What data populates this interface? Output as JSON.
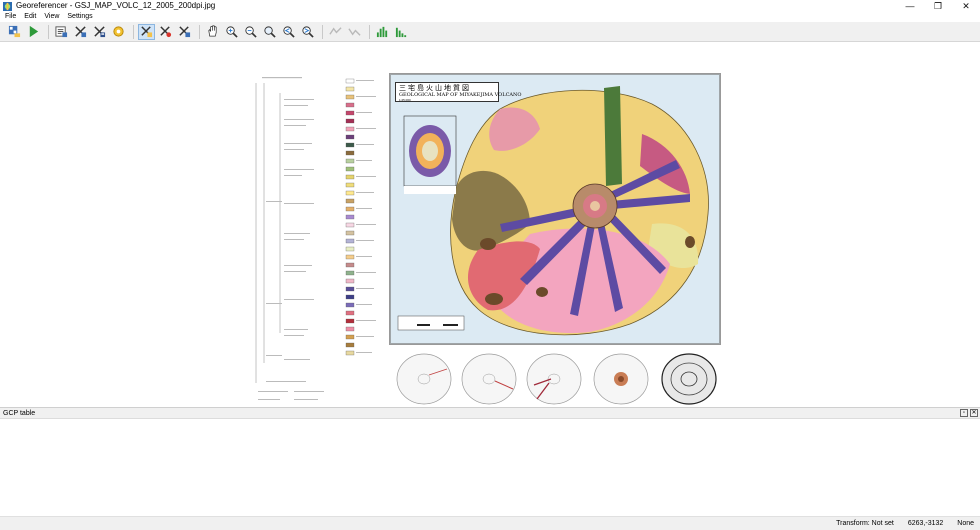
{
  "window": {
    "title": "Georeferencer - GSJ_MAP_VOLC_12_2005_200dpi.jpg",
    "minimize": "—",
    "maximize": "❐",
    "close": "✕"
  },
  "menu": [
    "File",
    "Edit",
    "View",
    "Settings"
  ],
  "toolbar": {
    "buttons": [
      {
        "name": "open-raster",
        "icon": "open-raster-icon"
      },
      {
        "name": "start-georeferencing",
        "icon": "play-icon"
      },
      {
        "name": "generate-gdal-script",
        "icon": "script-icon"
      },
      {
        "name": "load-gcp-points",
        "icon": "load-gcp-icon"
      },
      {
        "name": "save-gcp-points",
        "icon": "save-gcp-icon"
      },
      {
        "name": "transformation-settings",
        "icon": "gear-icon"
      },
      {
        "name": "add-point",
        "icon": "add-point-icon",
        "active": true
      },
      {
        "name": "delete-point",
        "icon": "delete-point-icon"
      },
      {
        "name": "move-gcp-point",
        "icon": "move-point-icon"
      },
      {
        "name": "pan",
        "icon": "pan-icon"
      },
      {
        "name": "zoom-in",
        "icon": "zoom-in-icon"
      },
      {
        "name": "zoom-out",
        "icon": "zoom-out-icon"
      },
      {
        "name": "zoom-to-layer",
        "icon": "zoom-layer-icon"
      },
      {
        "name": "zoom-last",
        "icon": "zoom-last-icon"
      },
      {
        "name": "zoom-next",
        "icon": "zoom-next-icon"
      },
      {
        "name": "link-georeferencer-to-qgis",
        "icon": "link-geo-icon",
        "disabled": true
      },
      {
        "name": "link-qgis-to-georeferencer",
        "icon": "link-qgis-icon",
        "disabled": true
      },
      {
        "name": "full-histogram-stretch",
        "icon": "histogram-full-icon"
      },
      {
        "name": "local-histogram-stretch",
        "icon": "histogram-local-icon"
      }
    ]
  },
  "map": {
    "title_jp": "三宅島火山地質図",
    "title_en": "GEOLOGICAL MAP OF MIYAKEJIMA VOLCANO",
    "subtitle": "1:25,000"
  },
  "gcp_panel": {
    "title": "GCP table",
    "float_glyph": "▫",
    "close_glyph": "✕"
  },
  "status": {
    "transform": "Transform: Not set",
    "coords": "6263,-3132",
    "crs": "None"
  }
}
